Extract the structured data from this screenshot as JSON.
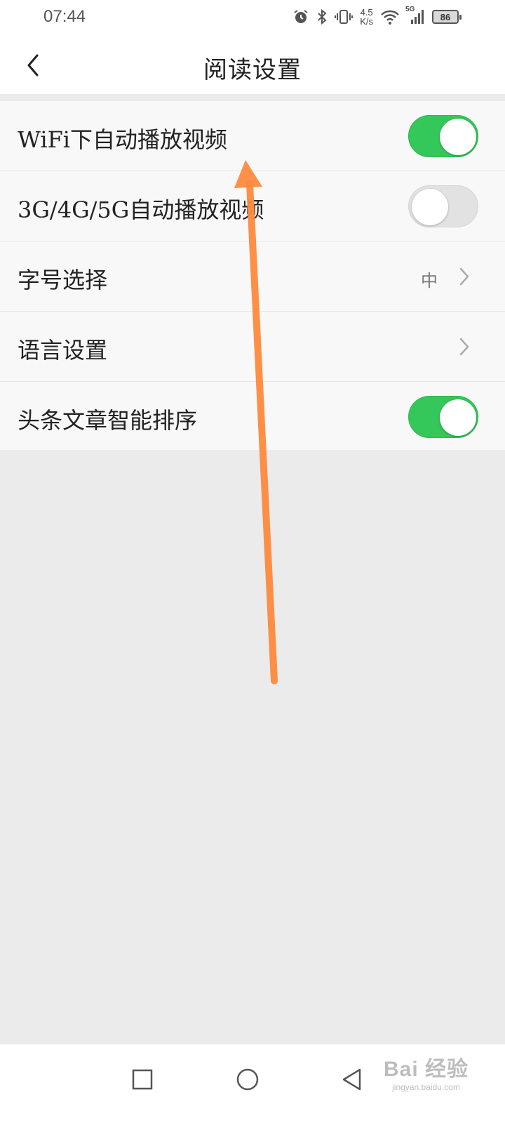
{
  "status_bar": {
    "time": "07:44",
    "speed_value": "4.5",
    "speed_unit": "K/s",
    "signal_label": "5G",
    "battery": "86"
  },
  "header": {
    "title": "阅读设置"
  },
  "settings": [
    {
      "label": "WiFi下自动播放视频",
      "type": "toggle",
      "on": true
    },
    {
      "label": "3G/4G/5G自动播放视频",
      "type": "toggle",
      "on": false
    },
    {
      "label": "字号选择",
      "type": "select",
      "value": "中"
    },
    {
      "label": "语言设置",
      "type": "link"
    },
    {
      "label": "头条文章智能排序",
      "type": "toggle",
      "on": true
    }
  ],
  "colors": {
    "toggle_on": "#34c759",
    "toggle_off": "#e2e2e2",
    "annotation_arrow": "#ff8a3d"
  },
  "watermark": {
    "brand": "Bai 经验",
    "url": "jingyan.baidu.com"
  }
}
